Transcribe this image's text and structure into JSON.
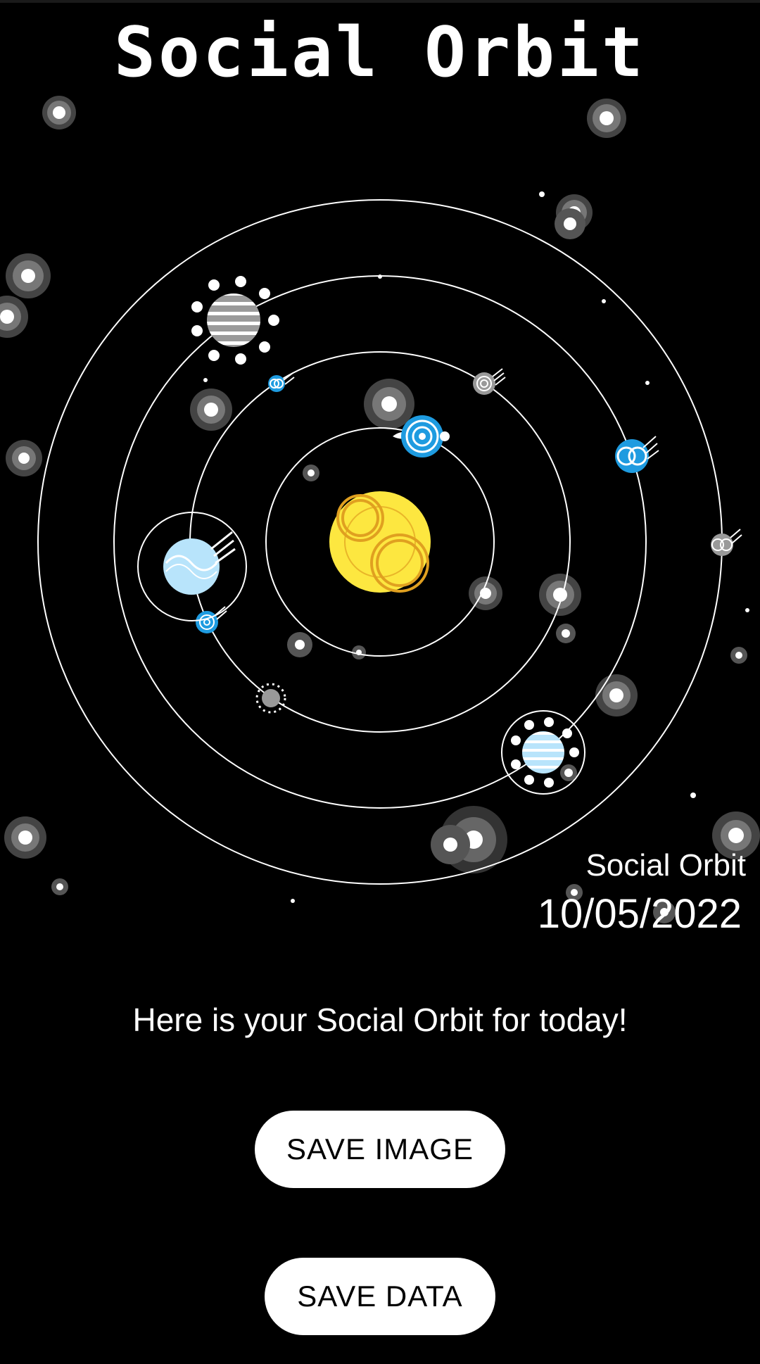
{
  "app": {
    "title": "Social Orbit"
  },
  "artwork": {
    "watermark_name": "Social Orbit",
    "date": "10/05/2022"
  },
  "message": "Here is your Social Orbit for today!",
  "buttons": {
    "save_image": "SAVE IMAGE",
    "save_data": "SAVE DATA"
  },
  "colors": {
    "background": "#000000",
    "sun": "#fde740",
    "sun_rings": "#e0a020",
    "blue_planet": "#1e9be0",
    "light_blue_planet": "#b8e4fb",
    "gray_planet": "#999999",
    "orbit_line": "#ffffff"
  }
}
